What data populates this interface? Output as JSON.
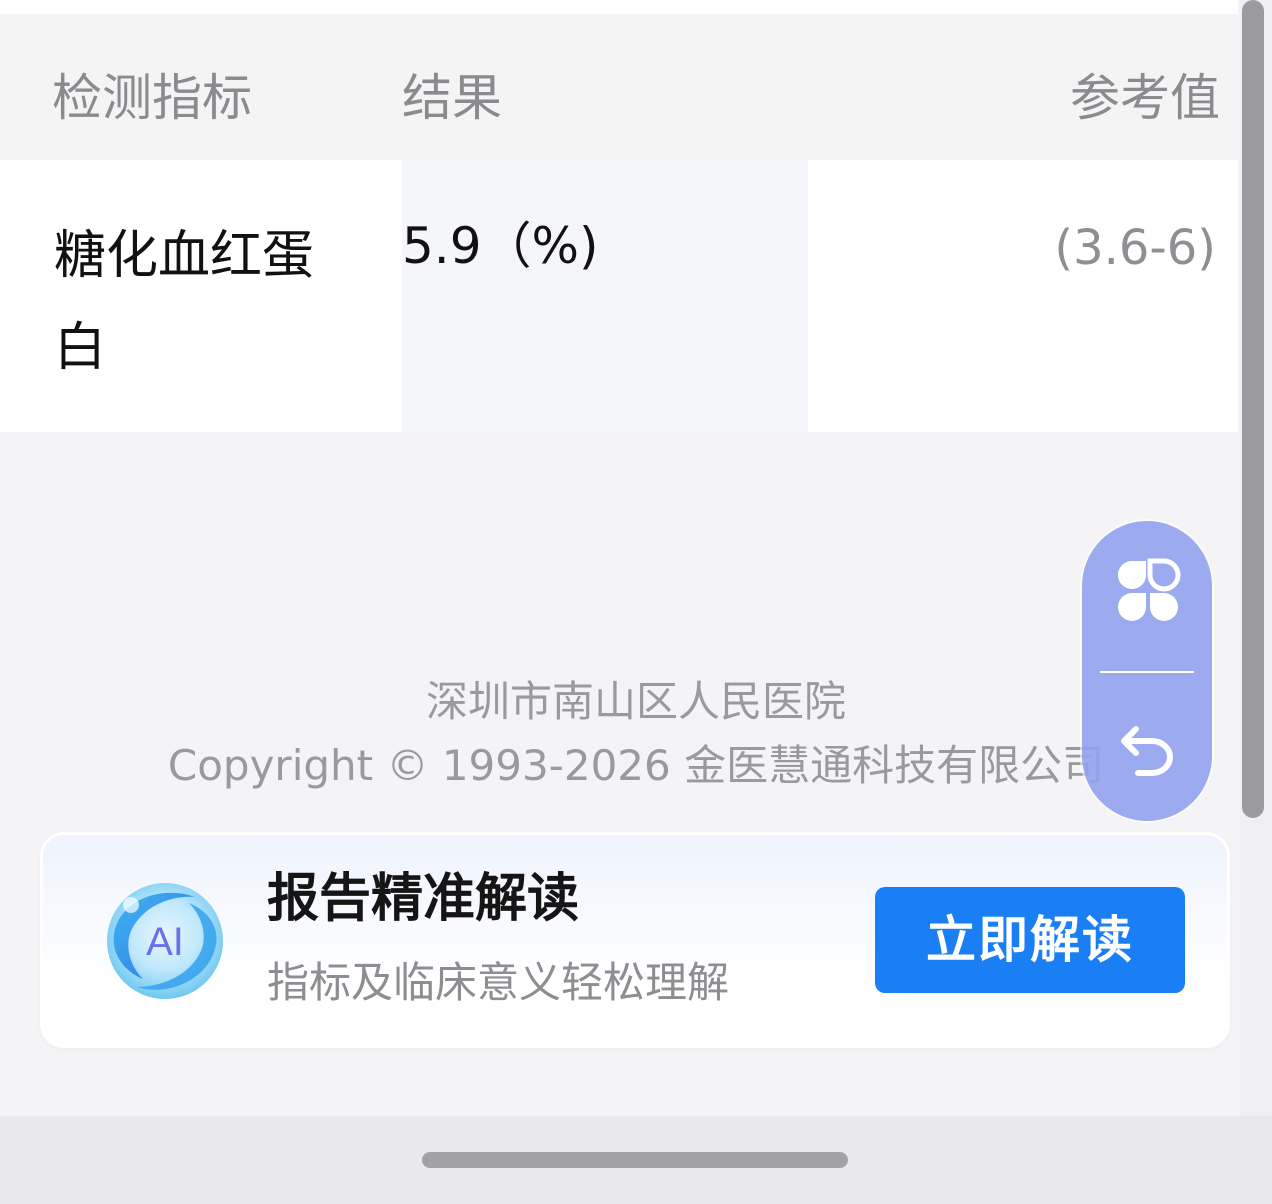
{
  "table": {
    "headers": {
      "indicator": "检测指标",
      "result": "结果",
      "reference": "参考值"
    },
    "rows": [
      {
        "indicator": "糖化血红蛋白",
        "result": "5.9（%)",
        "reference": "(3.6-6)"
      }
    ]
  },
  "footer": {
    "hospital": "深圳市南山区人民医院",
    "copyright": "Copyright © 1993-2026 金医慧通科技有限公司"
  },
  "float_widget": {
    "menu_icon": "four-petal-menu-icon",
    "back_icon": "undo-arrow-icon",
    "color": "#92a2ee"
  },
  "ai_banner": {
    "logo_text": "AI",
    "title": "报告精准解读",
    "subtitle": "指标及临床意义轻松理解",
    "button_label": "立即解读",
    "button_color": "#1a7ff4"
  }
}
